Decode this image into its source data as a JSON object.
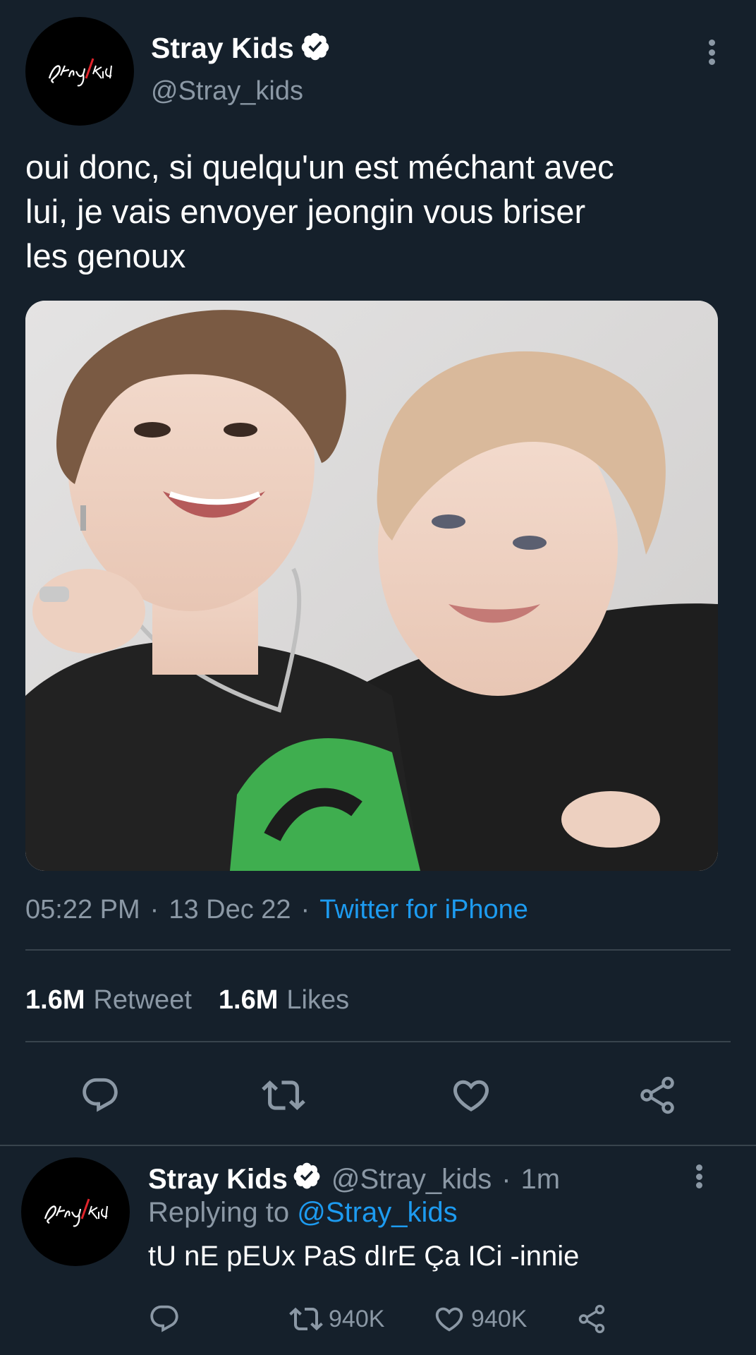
{
  "tweet": {
    "author": {
      "display_name": "Stray Kids",
      "handle": "@Stray_kids",
      "avatar_logo_text": "Stray Kids",
      "verified": true
    },
    "text_lines": [
      "oui donc, si quelqu'un est méchant avec",
      "lui, je vais envoyer jeongin vous briser",
      "les genoux"
    ],
    "media": {
      "type": "photo"
    },
    "meta": {
      "time": "05:22 PM",
      "separator": "·",
      "date": "13 Dec 22",
      "source": "Twitter for iPhone"
    },
    "stats": {
      "retweets_count": "1.6M",
      "retweets_label": "Retweet",
      "likes_count": "1.6M",
      "likes_label": "Likes"
    },
    "actions": [
      "reply-icon",
      "retweet-icon",
      "like-icon",
      "share-icon"
    ]
  },
  "reply": {
    "author": {
      "display_name": "Stray Kids",
      "handle": "@Stray_kids",
      "avatar_logo_text": "Stray Kids",
      "verified": true
    },
    "time_ago": "1m",
    "separator": "·",
    "replying_label": "Replying to",
    "replying_to": "@Stray_kids",
    "text": "tU nE pEUx PaS dIrE Ça ICi -innie",
    "actions": {
      "retweets": "940K",
      "likes": "940K"
    }
  },
  "colors": {
    "background": "#15202b",
    "accent": "#1d9bf0",
    "secondary_text": "#8b98a5",
    "divider": "#38444d"
  }
}
